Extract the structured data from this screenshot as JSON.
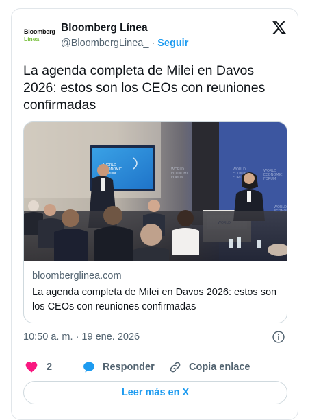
{
  "account": {
    "logo_line1": "Bloomberg",
    "logo_line2": "Línea",
    "display_name": "Bloomberg Línea",
    "handle": "@BloombergLinea_",
    "separator": "·",
    "follow_label": "Seguir"
  },
  "tweet": {
    "text": "La agenda completa de Milei en Davos 2026: estos son los CEOs con reuniones confirmadas"
  },
  "link_card": {
    "domain": "bloomberglinea.com",
    "title": "La agenda completa de Milei en Davos 2026: estos son los CEOs con reuniones confirmadas",
    "photo_caption_signs": [
      "WORLD ECONOMIC FORUM"
    ]
  },
  "meta": {
    "timestamp": "10:50 a. m. · 19 ene. 2026"
  },
  "actions": {
    "like_count": "2",
    "reply_label": "Responder",
    "copy_label": "Copia enlace"
  },
  "read_more_label": "Leer más en X",
  "colors": {
    "accent": "#1d9bf0",
    "like": "#f91880",
    "text": "#0f1419",
    "muted": "#536471",
    "brand_green": "#7cc242"
  },
  "icons": {
    "platform": "x-logo-icon",
    "info": "info-icon",
    "like": "heart-icon",
    "reply": "speech-bubble-icon",
    "copy": "link-icon"
  }
}
